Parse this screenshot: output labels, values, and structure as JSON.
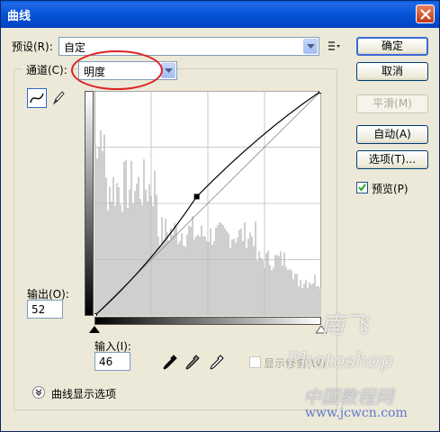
{
  "window": {
    "title": "曲线"
  },
  "preset": {
    "label": "预设(R):",
    "value": "自定"
  },
  "channel": {
    "label": "通道(C):",
    "value": "明度"
  },
  "output": {
    "label": "输出(O):",
    "value": "52"
  },
  "input": {
    "label": "输入(I):",
    "value": "46"
  },
  "buttons": {
    "ok": "确定",
    "cancel": "取消",
    "smooth": "平滑(M)",
    "auto": "自动(A)",
    "options": "选项(T)...",
    "preview": "预览(P)"
  },
  "preview_checked": true,
  "show_clipping": "显示修剪(W)",
  "curve_display_options": "曲线显示选项",
  "watermark": {
    "line1": "南飞",
    "line2": "Photoshop",
    "line3": "中国教程网",
    "site": "www.jcwcn.com"
  },
  "colors": {
    "title_bar": "#0553d8",
    "highlight_ring": "#dd2222",
    "dialog_bg": "#ece9d8"
  },
  "curve": {
    "control_point": {
      "input": 46,
      "output": 52
    }
  }
}
